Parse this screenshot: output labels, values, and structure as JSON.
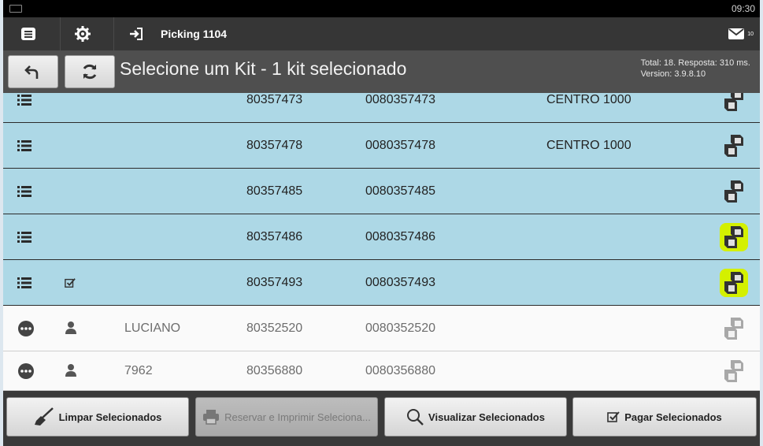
{
  "status_bar": {
    "time": "09:30"
  },
  "action_bar": {
    "title": "Picking 1104",
    "mail_count": "10"
  },
  "sub_bar": {
    "title": "Selecione um Kit - 1 kit selecionado",
    "info_line1": "Total: 18. Resposta: 310 ms.",
    "info_line2": "Version: 3.9.8.10"
  },
  "rows": [
    {
      "name": "",
      "code": "80357473",
      "code_full": "0080357473",
      "centro": "CENTRO 1000",
      "selected": true,
      "checked": false
    },
    {
      "name": "",
      "code": "80357478",
      "code_full": "0080357478",
      "centro": "CENTRO 1000",
      "selected": true,
      "checked": false
    },
    {
      "name": "",
      "code": "80357485",
      "code_full": "0080357485",
      "centro": "",
      "selected": true,
      "checked": false
    },
    {
      "name": "",
      "code": "80357486",
      "code_full": "0080357486",
      "centro": "",
      "selected": true,
      "checked": false
    },
    {
      "name": "",
      "code": "80357493",
      "code_full": "0080357493",
      "centro": "",
      "selected": true,
      "checked": true
    },
    {
      "name": "LUCIANO",
      "code": "80352520",
      "code_full": "0080352520",
      "centro": "",
      "selected": false,
      "checked": false
    },
    {
      "name": "7962",
      "code": "80356880",
      "code_full": "0080356880",
      "centro": "",
      "selected": false,
      "checked": false
    }
  ],
  "footer": {
    "clear_label": "Limpar Selecionados",
    "reserve_label": "Reservar e Imprimir Seleciona...",
    "view_label": "Visualizar Selecionados",
    "pay_label": "Pagar Selecionados"
  },
  "colors": {
    "selected_row": "#add8e6",
    "highlight": "#d4f000"
  },
  "icons": {
    "menu": "list-alt-icon",
    "settings": "gear-icon",
    "logout": "sign-in-icon",
    "mail": "envelope-icon",
    "back": "undo-icon",
    "refresh": "refresh-icon",
    "row_list": "list-icon",
    "row_more": "ellipsis-circle-icon",
    "row_user": "user-icon",
    "box": "boxes-icon",
    "broom": "broom-icon",
    "printer": "printer-icon",
    "search": "search-icon",
    "check": "check-square-icon"
  }
}
